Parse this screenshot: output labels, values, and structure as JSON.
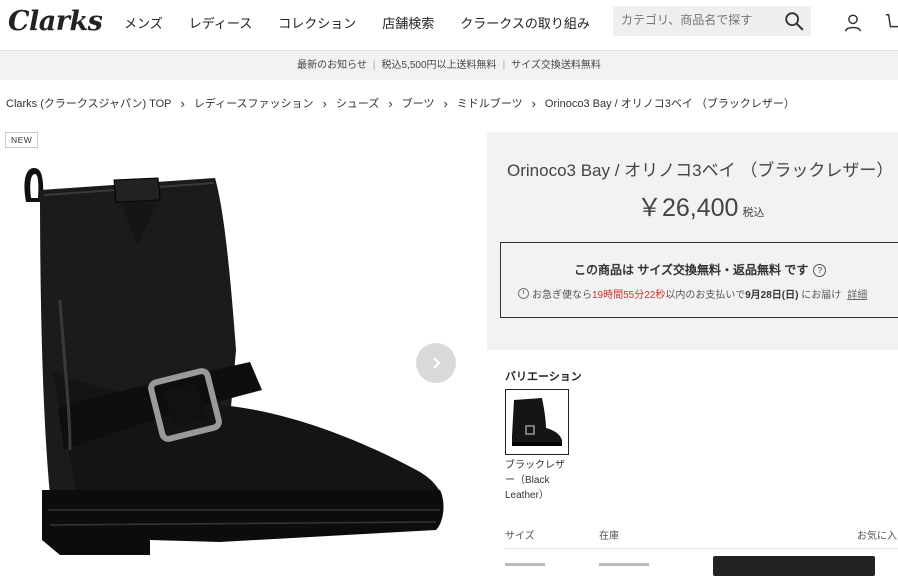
{
  "header": {
    "logo": "Clarks",
    "nav": [
      "メンズ",
      "レディース",
      "コレクション",
      "店舗検索",
      "クラークスの取り組み"
    ],
    "search_placeholder": "カテゴリ、商品名で探す"
  },
  "announcement": {
    "items": [
      "最新のお知らせ",
      "税込5,500円以上送料無料",
      "サイズ交換送料無料"
    ]
  },
  "breadcrumb": [
    "Clarks (クラークスジャパン) TOP",
    "レディースファッション",
    "シューズ",
    "ブーツ",
    "ミドルブーツ",
    "Orinoco3 Bay / オリノコ3ベイ （ブラックレザー）"
  ],
  "product": {
    "badge": "NEW",
    "title": "Orinoco3 Bay / オリノコ3ベイ （ブラックレザー）",
    "price": "￥26,400",
    "tax_label": "税込"
  },
  "notice": {
    "title_pre": "この商品は ",
    "title_bold": "サイズ交換無料・返品無料",
    "title_post": " です",
    "delivery_pre": "お急ぎ便なら",
    "delivery_time": "19時間55分22秒",
    "delivery_mid": "以内のお支払いで",
    "delivery_date": "9月28日(日)",
    "delivery_post": " にお届け",
    "details_link": "詳細"
  },
  "variation": {
    "label": "バリエーション",
    "name": "ブラックレザー（Black Leather）"
  },
  "size_table": {
    "size_header": "サイズ",
    "stock_header": "在庫",
    "fav_header": "お気に入り"
  },
  "colors": {
    "accent_red": "#d0312d",
    "panel_bg": "#f2f2f2"
  }
}
